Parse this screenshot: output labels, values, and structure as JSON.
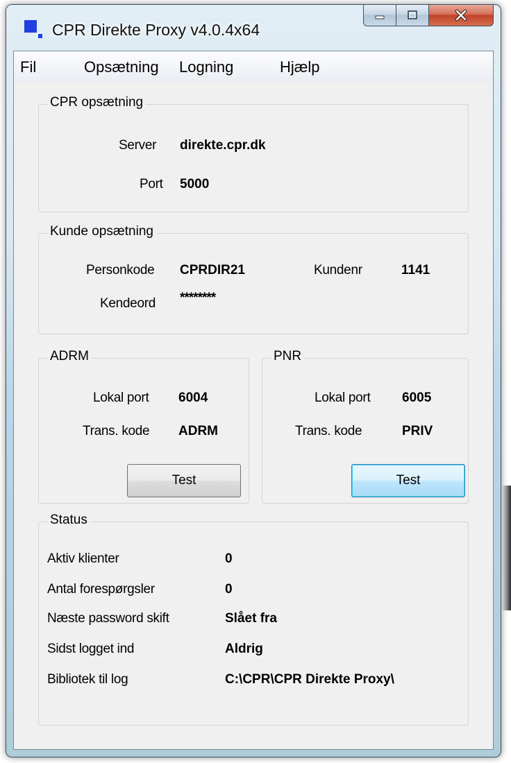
{
  "window": {
    "title": "CPR Direkte Proxy v4.0.4x64",
    "accent_color": "#1f3fe0"
  },
  "menu": [
    "Fil",
    "Opsætning",
    "Logning",
    "Hjælp"
  ],
  "cpr_setup": {
    "legend": "CPR opsætning",
    "server_label": "Server",
    "server_value": "direkte.cpr.dk",
    "port_label": "Port",
    "port_value": "5000"
  },
  "customer_setup": {
    "legend": "Kunde opsætning",
    "personkode_label": "Personkode",
    "personkode_value": "CPRDIR21",
    "kundenr_label": "Kundenr",
    "kundenr_value": "1141",
    "kendeord_label": "Kendeord",
    "kendeord_value": "********"
  },
  "adrm": {
    "legend": "ADRM",
    "local_port_label": "Lokal port",
    "local_port_value": "6004",
    "trans_code_label": "Trans. kode",
    "trans_code_value": "ADRM",
    "test_label": "Test"
  },
  "pnr": {
    "legend": "PNR",
    "local_port_label": "Lokal port",
    "local_port_value": "6005",
    "trans_code_label": "Trans. kode",
    "trans_code_value": "PRIV",
    "test_label": "Test"
  },
  "status": {
    "legend": "Status",
    "rows": [
      {
        "label": "Aktiv klienter",
        "value": "0"
      },
      {
        "label": "Antal forespørgsler",
        "value": "0"
      },
      {
        "label": "Næste password skift",
        "value": "Slået fra"
      },
      {
        "label": "Sidst logget ind",
        "value": "Aldrig"
      },
      {
        "label": "Bibliotek til log",
        "value": "C:\\CPR\\CPR Direkte Proxy\\"
      }
    ]
  }
}
